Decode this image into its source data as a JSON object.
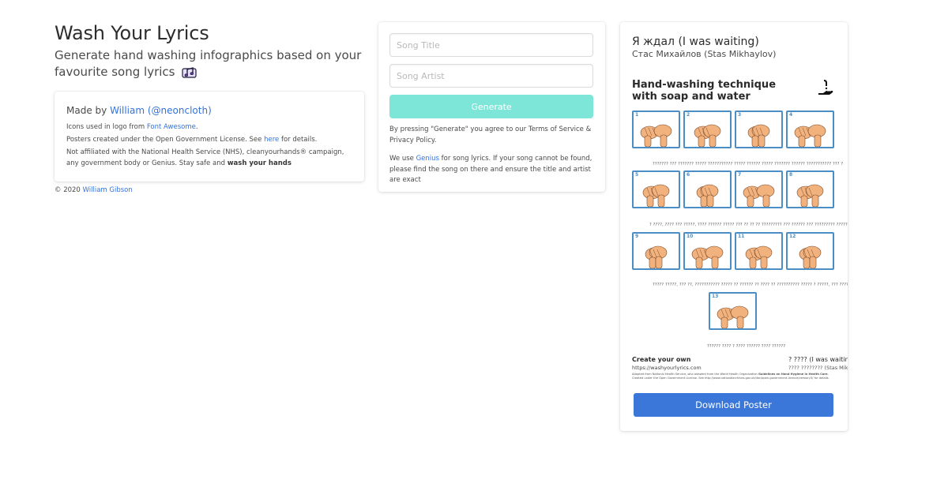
{
  "header": {
    "title": "Wash Your Lyrics",
    "subtitle": "Generate hand washing infographics based on your favourite song lyrics",
    "subtitle_icon": "music-notes-icon"
  },
  "info": {
    "made_by_prefix": "Made by ",
    "author_name": "William",
    "author_handle": "(@neoncloth)",
    "icons_prefix": "Icons used in logo from ",
    "icons_link": "Font Awesome",
    "icons_suffix": ".",
    "license_prefix": "Posters created under the Open Government License. See ",
    "license_link": "here",
    "license_suffix": " for details.",
    "affiliation_text": "Not affiliated with the National Health Service (NHS), cleanyourhands® campaign, any government body or Genius. Stay safe and ",
    "affiliation_bold": "wash your hands"
  },
  "footer": {
    "copyright_prefix": "© 2020 ",
    "copyright_link": "William Gibson"
  },
  "form": {
    "song_title_placeholder": "Song Title",
    "song_artist_placeholder": "Song Artist",
    "generate_label": "Generate",
    "terms_text": "By pressing \"Generate\" you agree to our Terms of Service & Privacy Policy.",
    "genius_prefix": "We use ",
    "genius_link": "Genius",
    "genius_suffix": " for song lyrics. If your song cannot be found, please find the song on there and ensure the title and artist are exact"
  },
  "poster": {
    "song_title": "Я ждал (I was waiting)",
    "song_artist": "Стас Михайлов (Stas Mikhaylov)",
    "technique_title_line1": "Hand-washing technique",
    "technique_title_line2": "with soap and water",
    "step_numbers": [
      "1",
      "2",
      "3",
      "4",
      "5",
      "6",
      "7",
      "8",
      "9",
      "10",
      "11",
      "12",
      "13"
    ],
    "lyric_rows": [
      "??????? ??? ??????? ????? ??????????? ????? ?????? ????? ??????? ?????? ??????????? ??? ?",
      "? ????, ???? ??? ?????, ???? ?????? ????? ??? ?? ?? ?? ????????? ??? ?????? ??? ????????? ?????",
      "????? ?????, ??? ??, ??????????? ????? ?? ?????? ?? ???? ?? ?????????? ????? ? ?????, ??? ???????????",
      "?????? ???? ? ???? ?????? ???? ??????"
    ],
    "create_own": "Create your own",
    "site_url": "https://washyourlyrics.com",
    "footer_song": "? ???? (I was waiting)",
    "footer_artist": "???? ???????? (Stas Mikhaylov)",
    "adapted_prefix": "Adapted from National Health Service, who adapted from the World Health Organization ",
    "adapted_bold": "Guidelines on Hand Hygiene in Health Care.",
    "license_line": "Created under the Open Government License. See http://www.nationalarchives.gov.uk/doc/open-government-licence/version/3/ for details."
  },
  "download_label": "Download Poster",
  "colors": {
    "link": "#3273dc",
    "generate_button": "#7ee6d8",
    "download_button": "#3a77d8",
    "step_border": "#4a8ec5",
    "hand_skin": "#f2b27e"
  }
}
